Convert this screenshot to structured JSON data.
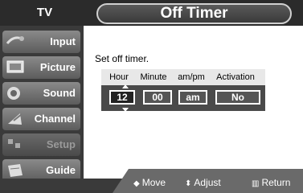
{
  "header": {
    "tv_label": "TV",
    "title": "Off Timer"
  },
  "sidebar": {
    "items": [
      {
        "label": "Input",
        "icon": "input-plug-icon",
        "enabled": true
      },
      {
        "label": "Picture",
        "icon": "picture-monitor-icon",
        "enabled": true
      },
      {
        "label": "Sound",
        "icon": "speaker-icon",
        "enabled": true
      },
      {
        "label": "Channel",
        "icon": "channel-dish-icon",
        "enabled": true
      },
      {
        "label": "Setup",
        "icon": "setup-icon",
        "enabled": false
      },
      {
        "label": "Guide",
        "icon": "guide-icon",
        "enabled": true
      }
    ]
  },
  "main": {
    "subtitle": "Set off timer.",
    "columns": [
      "Hour",
      "Minute",
      "am/pm",
      "Activation"
    ],
    "values": {
      "hour": "12",
      "minute": "00",
      "ampm": "am",
      "activation": "No"
    }
  },
  "footer": {
    "move": {
      "glyph": "◆",
      "label": "Move"
    },
    "adjust": {
      "glyph": "⬍",
      "label": "Adjust"
    },
    "return": {
      "glyph": "▥",
      "label": "Return"
    }
  }
}
